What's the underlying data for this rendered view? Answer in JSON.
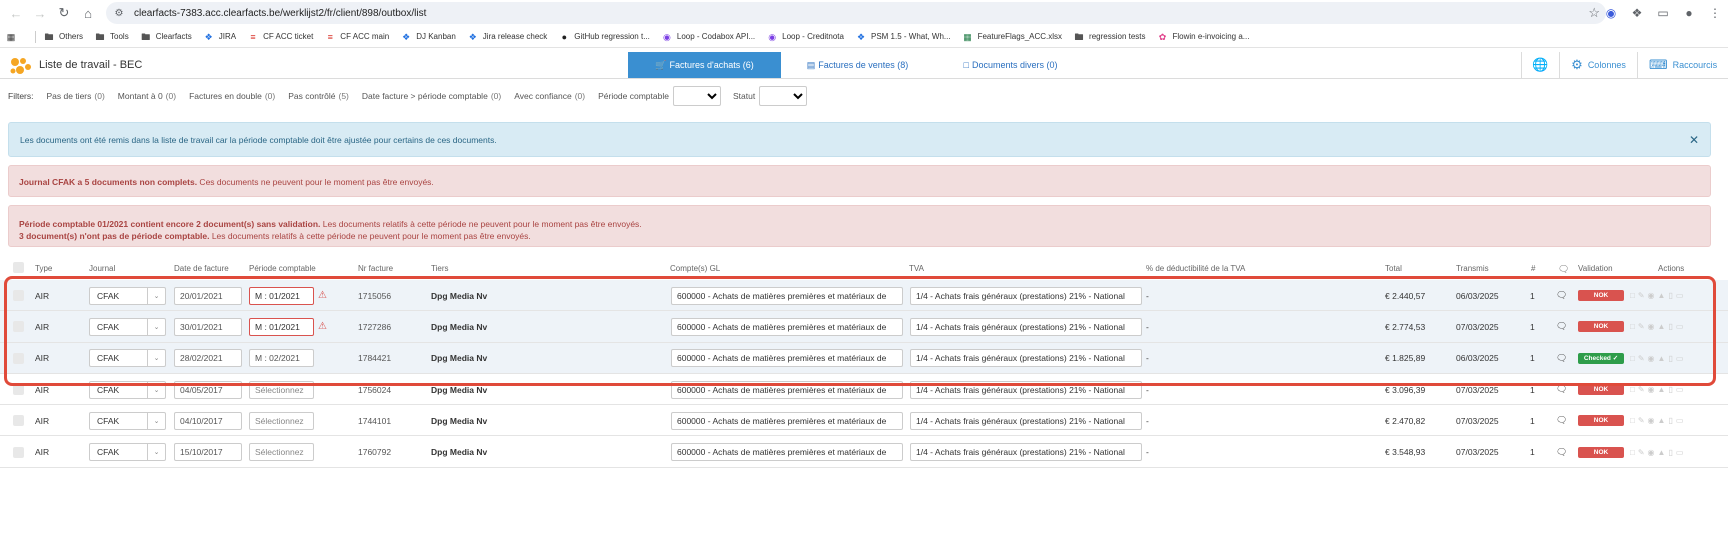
{
  "browser": {
    "url": "clearfacts-7383.acc.clearfacts.be/werklijst2/fr/client/898/outbox/list",
    "bookmarks": [
      {
        "label": "Others",
        "icon": "folder-icon"
      },
      {
        "label": "Tools",
        "icon": "folder-icon"
      },
      {
        "label": "Clearfacts",
        "icon": "folder-icon"
      },
      {
        "label": "JIRA",
        "icon": "jira-icon"
      },
      {
        "label": "CF ACC ticket",
        "icon": "cf-icon"
      },
      {
        "label": "CF ACC main",
        "icon": "cf-icon"
      },
      {
        "label": "DJ Kanban",
        "icon": "jira-icon"
      },
      {
        "label": "Jira release check",
        "icon": "jira-icon"
      },
      {
        "label": "GitHub regression t...",
        "icon": "github-icon"
      },
      {
        "label": "Loop - Codabox API...",
        "icon": "loop-icon"
      },
      {
        "label": "Loop - Creditnota",
        "icon": "loop-icon"
      },
      {
        "label": "PSM 1.5 - What, Wh...",
        "icon": "jira-icon"
      },
      {
        "label": "FeatureFlags_ACC.xlsx",
        "icon": "excel-icon"
      },
      {
        "label": "regression tests",
        "icon": "folder-icon"
      },
      {
        "label": "Flowin e-invoicing a...",
        "icon": "flowin-icon"
      }
    ]
  },
  "header": {
    "title": "Liste de travail - BEC",
    "tabs": [
      {
        "label": "Factures d'achats (6)"
      },
      {
        "label": "Factures de ventes (8)"
      },
      {
        "label": "Documents divers (0)"
      }
    ],
    "columns_label": "Colonnes",
    "shortcuts_label": "Raccourcis"
  },
  "filters": {
    "label": "Filters:",
    "items": [
      {
        "name": "Pas de tiers",
        "count": "(0)"
      },
      {
        "name": "Montant à 0",
        "count": "(0)"
      },
      {
        "name": "Factures en double",
        "count": "(0)"
      },
      {
        "name": "Pas contrôlé",
        "count": "(5)"
      },
      {
        "name": "Date facture > période comptable",
        "count": "(0)"
      },
      {
        "name": "Avec confiance",
        "count": "(0)"
      }
    ],
    "period_label": "Période comptable",
    "status_label": "Statut"
  },
  "alerts": {
    "info": "Les documents ont été remis dans la liste de travail car la période comptable doit être ajustée pour certains de ces documents.",
    "journal_bold": "Journal CFAK a 5 documents non complets.",
    "journal_text": " Ces documents ne peuvent pour le moment pas être envoyés.",
    "period_bold": "Période comptable 01/2021 contient encore 2 document(s) sans validation.",
    "period_text": " Les documents relatifs à cette période ne peuvent pour le moment pas être envoyés.",
    "noperiod_bold": "3 document(s) n'ont pas de période comptable.",
    "noperiod_text": " Les documents relatifs à cette période ne peuvent pour le moment pas être envoyés."
  },
  "table": {
    "headers": {
      "type": "Type",
      "journal": "Journal",
      "date": "Date de facture",
      "period": "Période comptable",
      "nr": "Nr facture",
      "tiers": "Tiers",
      "gl": "Compte(s) GL",
      "tva": "TVA",
      "deduct": "% de déductibilité de la TVA",
      "total": "Total",
      "transmis": "Transmis",
      "hash": "#",
      "validation": "Validation",
      "actions": "Actions"
    },
    "rows": [
      {
        "type": "AIR",
        "journal": "CFAK",
        "date": "20/01/2021",
        "period": "M : 01/2021",
        "nr": "1715056",
        "tiers": "Dpg Media Nv",
        "gl": "600000 - Achats de matières premières et matériaux de",
        "tva": "1/4 - Achats frais généraux (prestations) 21% - National",
        "deduct": "-",
        "total": "€ 2.440,57",
        "transmis": "06/03/2025",
        "count": "1",
        "validation": "NOK"
      },
      {
        "type": "AIR",
        "journal": "CFAK",
        "date": "30/01/2021",
        "period": "M : 01/2021",
        "nr": "1727286",
        "tiers": "Dpg Media Nv",
        "gl": "600000 - Achats de matières premières et matériaux de",
        "tva": "1/4 - Achats frais généraux (prestations) 21% - National",
        "deduct": "-",
        "total": "€ 2.774,53",
        "transmis": "07/03/2025",
        "count": "1",
        "validation": "NOK"
      },
      {
        "type": "AIR",
        "journal": "CFAK",
        "date": "28/02/2021",
        "period": "M : 02/2021",
        "nr": "1784421",
        "tiers": "Dpg Media Nv",
        "gl": "600000 - Achats de matières premières et matériaux de",
        "tva": "1/4 - Achats frais généraux (prestations) 21% - National",
        "deduct": "-",
        "total": "€ 1.825,89",
        "transmis": "06/03/2025",
        "count": "1",
        "validation": "Checked ✓"
      },
      {
        "type": "AIR",
        "journal": "CFAK",
        "date": "04/05/2017",
        "period": "Sélectionnez",
        "nr": "1756024",
        "tiers": "Dpg Media Nv",
        "gl": "600000 - Achats de matières premières et matériaux de",
        "tva": "1/4 - Achats frais généraux (prestations) 21% - National",
        "deduct": "-",
        "total": "€ 3.096,39",
        "transmis": "07/03/2025",
        "count": "1",
        "validation": "NOK"
      },
      {
        "type": "AIR",
        "journal": "CFAK",
        "date": "04/10/2017",
        "period": "Sélectionnez",
        "nr": "1744101",
        "tiers": "Dpg Media Nv",
        "gl": "600000 - Achats de matières premières et matériaux de",
        "tva": "1/4 - Achats frais généraux (prestations) 21% - National",
        "deduct": "-",
        "total": "€ 2.470,82",
        "transmis": "07/03/2025",
        "count": "1",
        "validation": "NOK"
      },
      {
        "type": "AIR",
        "journal": "CFAK",
        "date": "15/10/2017",
        "period": "Sélectionnez",
        "nr": "1760792",
        "tiers": "Dpg Media Nv",
        "gl": "600000 - Achats de matières premières et matériaux de",
        "tva": "1/4 - Achats frais généraux (prestations) 21% - National",
        "deduct": "-",
        "total": "€ 3.548,93",
        "transmis": "07/03/2025",
        "count": "1",
        "validation": "NOK"
      }
    ]
  },
  "colors": {
    "accent": "#3a8fd1",
    "danger": "#d9534f",
    "success": "#2e9d4a",
    "highlight": "#e04a3a"
  }
}
